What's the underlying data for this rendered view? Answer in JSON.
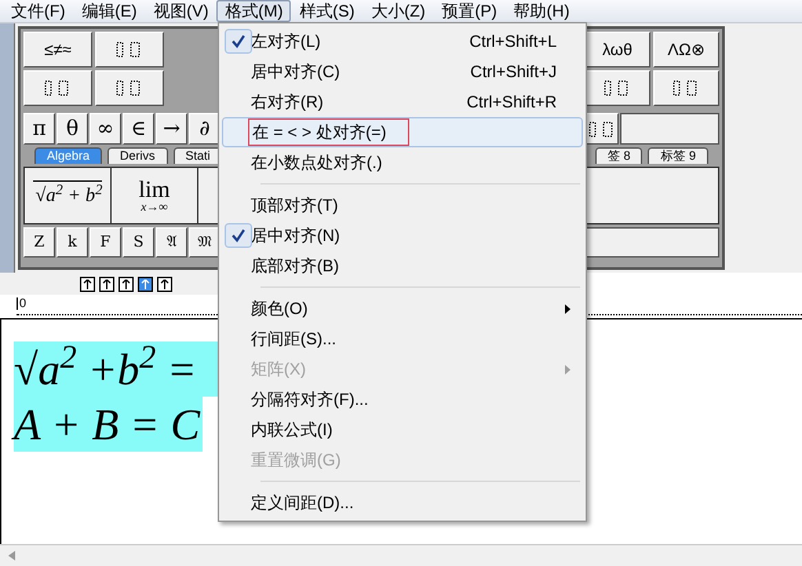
{
  "menubar": [
    {
      "label": "文件(F)",
      "selected": false
    },
    {
      "label": "编辑(E)",
      "selected": false
    },
    {
      "label": "视图(V)",
      "selected": false
    },
    {
      "label": "格式(M)",
      "selected": true
    },
    {
      "label": "样式(S)",
      "selected": false
    },
    {
      "label": "大小(Z)",
      "selected": false
    },
    {
      "label": "预置(P)",
      "selected": false
    },
    {
      "label": "帮助(H)",
      "selected": false
    }
  ],
  "palette": {
    "row1_left": [
      "≤≠≈"
    ],
    "row1_right": [
      "λωθ",
      "ΛΩ⊗"
    ],
    "symbols": [
      "π",
      "θ",
      "∞",
      "∈",
      "→",
      "∂"
    ],
    "tabs": [
      {
        "label": "Algebra",
        "selected": true
      },
      {
        "label": "Derivs",
        "selected": false
      },
      {
        "label": "Stati",
        "selected": false
      },
      {
        "label": "签 8",
        "selected": false
      },
      {
        "label": "标签 9",
        "selected": false
      }
    ],
    "templates": [
      {
        "kind": "root",
        "text": "√a$^{2}$ + b$^{2}$"
      },
      {
        "kind": "limit",
        "text": "lim",
        "sub": "x→∞"
      }
    ],
    "fonts": [
      "Z",
      "k",
      "F",
      "S",
      "𝔄",
      "𝔐"
    ]
  },
  "small_buttons": [
    {
      "selected": false
    },
    {
      "selected": false
    },
    {
      "selected": false
    },
    {
      "selected": true
    },
    {
      "selected": false
    }
  ],
  "ruler": {
    "origin": "0"
  },
  "document": {
    "lines": [
      "√a$^{2}$ +b$^{2}$ =",
      "A + B = C"
    ]
  },
  "menu": [
    {
      "kind": "item",
      "label": "左对齐(L)",
      "shortcut": "Ctrl+Shift+L",
      "checked": true
    },
    {
      "kind": "item",
      "label": "居中对齐(C)",
      "shortcut": "Ctrl+Shift+J",
      "checked": false
    },
    {
      "kind": "item",
      "label": "右对齐(R)",
      "shortcut": "Ctrl+Shift+R",
      "checked": false
    },
    {
      "kind": "item",
      "label": "在 = < > 处对齐(=)",
      "checked": false,
      "highlighted": true,
      "annotated": true
    },
    {
      "kind": "item",
      "label": "在小数点处对齐(.)",
      "checked": false
    },
    {
      "kind": "separator"
    },
    {
      "kind": "item",
      "label": "顶部对齐(T)",
      "checked": false
    },
    {
      "kind": "item",
      "label": "居中对齐(N)",
      "checked": true
    },
    {
      "kind": "item",
      "label": "底部对齐(B)",
      "checked": false
    },
    {
      "kind": "separator"
    },
    {
      "kind": "item",
      "label": "颜色(O)",
      "checked": false,
      "submenu": true
    },
    {
      "kind": "item",
      "label": "行间距(S)...",
      "checked": false
    },
    {
      "kind": "item",
      "label": "矩阵(X)",
      "checked": false,
      "submenu": true,
      "disabled": true
    },
    {
      "kind": "item",
      "label": "分隔符对齐(F)...",
      "checked": false
    },
    {
      "kind": "item",
      "label": "内联公式(I)",
      "checked": false
    },
    {
      "kind": "item",
      "label": "重置微调(G)",
      "checked": false,
      "disabled": true
    },
    {
      "kind": "separator"
    },
    {
      "kind": "item",
      "label": "定义间距(D)...",
      "checked": false
    }
  ]
}
